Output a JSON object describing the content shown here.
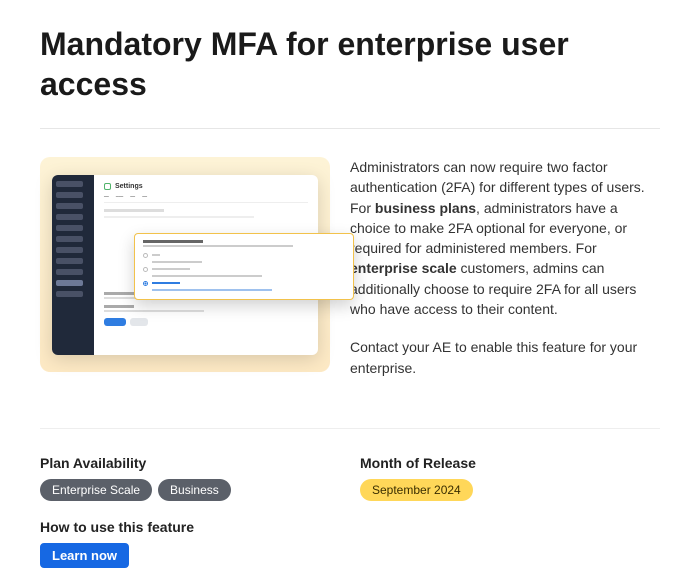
{
  "title": "Mandatory MFA for enterprise user access",
  "illustration": {
    "settings_header": "Settings"
  },
  "description": {
    "p1_a": "Administrators can now require two factor authentication (2FA) for different types of users. For ",
    "p1_b1": "business plans",
    "p1_c": ", administrators have a choice to make 2FA optional for everyone, or required for administered members. For ",
    "p1_b2": "enterprise scale",
    "p1_d": " customers, admins can additionally choose to require 2FA for all users who have access to their content.",
    "p2": "Contact your AE to enable this feature for your enterprise."
  },
  "meta": {
    "plan_heading": "Plan Availability",
    "plan_badges": [
      "Enterprise Scale",
      "Business"
    ],
    "release_heading": "Month of Release",
    "release_badge": "September 2024"
  },
  "howto": {
    "heading": "How to use this feature",
    "button": "Learn now"
  }
}
